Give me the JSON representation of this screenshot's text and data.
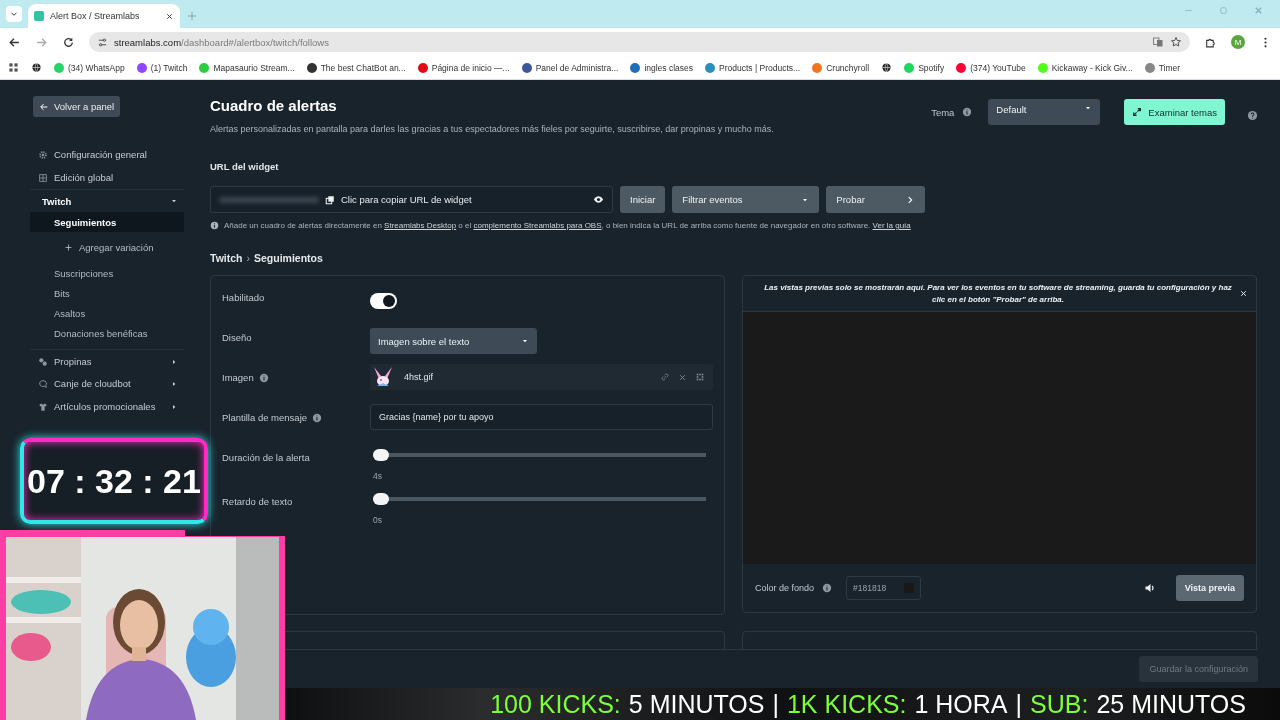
{
  "browser": {
    "tab_title": "Alert Box / Streamlabs",
    "url_host": "streamlabs.com",
    "url_path": "/dashboard#/alertbox/twitch/follows",
    "profile_initial": "M",
    "bookmarks": [
      {
        "color": "#222222"
      },
      {
        "label": "(34) WhatsApp",
        "color": "#25d366"
      },
      {
        "label": "(1) Twitch",
        "color": "#9146ff"
      },
      {
        "label": "Mapasaurio Stream...",
        "color": "#2ecc40"
      },
      {
        "label": "The best ChatBot an...",
        "color": "#333333"
      },
      {
        "label": "Página de inicio —...",
        "color": "#e50914"
      },
      {
        "label": "Panel de Administra...",
        "color": "#3b5998"
      },
      {
        "label": "ingles clases",
        "color": "#1e6fb8"
      },
      {
        "label": "Products | Products...",
        "color": "#2a8fbd"
      },
      {
        "label": "Crunchyroll",
        "color": "#f47521"
      },
      {
        "color": "#222222"
      },
      {
        "label": "Spotify",
        "color": "#1ed760"
      },
      {
        "label": "(374) YouTube",
        "color": "#ff0033"
      },
      {
        "label": "Kickaway - Kick Giv...",
        "color": "#53fc18"
      },
      {
        "label": "Timer",
        "color": "#888888"
      }
    ]
  },
  "sidebar": {
    "back_button": "Volver a panel",
    "items": [
      {
        "label": "Configuración general",
        "kind": "gear"
      },
      {
        "label": "Edición global",
        "kind": "grid"
      },
      {
        "label": "Twitch",
        "kind": "group",
        "expanded": true,
        "children": [
          {
            "label": "Seguimientos",
            "selected": true
          },
          {
            "label": "Agregar variación",
            "kind": "add",
            "selected": false
          },
          {
            "label": "Suscripciones",
            "selected": false
          },
          {
            "label": "Bits",
            "selected": false
          },
          {
            "label": "Asaltos",
            "selected": false
          },
          {
            "label": "Donaciones benéficas",
            "selected": false
          }
        ]
      },
      {
        "label": "Propinas",
        "kind": "coins",
        "expanded": false
      },
      {
        "label": "Canje de cloudbot",
        "kind": "chat",
        "expanded": false
      },
      {
        "label": "Artículos promocionales",
        "kind": "shirt",
        "expanded": false
      }
    ]
  },
  "header": {
    "title": "Cuadro de alertas",
    "subtitle": "Alertas personalizadas en pantalla para darles las gracias a tus espectadores más fieles por seguirte, suscribirse, dar propinas y mucho más.",
    "theme_label": "Tema",
    "theme_value": "Default",
    "browse_button": "Examinar temas"
  },
  "widget": {
    "label": "URL del widget",
    "copy_text": "Clic para copiar URL de widget",
    "start_button": "Iniciar",
    "filter_select": "Filtrar eventos",
    "test_button": "Probar",
    "info": [
      {
        "text": "Añade un cuadro de alertas directamente en "
      },
      {
        "text": "Streamlabs Desktop",
        "link": true
      },
      {
        "text": " o el "
      },
      {
        "text": "complemento Streamlabs para OBS",
        "link": true
      },
      {
        "text": ", o bien indica la URL de arriba como fuente de navegador en otro software. "
      },
      {
        "text": "Ver la guía",
        "link": true
      }
    ]
  },
  "breadcrumb": [
    "Twitch",
    "›",
    "Seguimientos"
  ],
  "settings": [
    {
      "label": "Habilitado",
      "kind": "toggle",
      "on": true
    },
    {
      "label": "Diseño",
      "kind": "select",
      "value": "Imagen sobre el texto"
    },
    {
      "label": "Imagen",
      "kind": "file",
      "info": true,
      "value": "4hst.gif"
    },
    {
      "label": "Plantilla de mensaje",
      "kind": "text",
      "info": true,
      "value": "Gracias {name} por tu apoyo"
    },
    {
      "label": "Duración de la alerta",
      "kind": "slider",
      "level": 0,
      "reading": "4s"
    },
    {
      "label": "Retardo de texto",
      "kind": "slider",
      "level": 0,
      "reading": "0s"
    }
  ],
  "preview": {
    "notice": "Las vistas previas solo se mostrarán aquí. Para ver los eventos en tu software de streaming, guarda tu configuración y haz clic en el botón \"Probar\" de arriba.",
    "bg_label": "Color de fondo",
    "bg_value": "#181818",
    "preview_button": "Vista previa"
  },
  "save_button": {
    "label": "Guardar la configuración",
    "disabled": true
  },
  "overlay": {
    "timer": "07 : 32 : 21",
    "ticker": [
      {
        "text": "100 KICKS:",
        "color": "#7dff3a"
      },
      {
        "text": "5 MINUTOS",
        "color": "#ffffff"
      },
      {
        "text": "|",
        "color": "#ffffff"
      },
      {
        "text": "1K KICKS:",
        "color": "#7dff3a"
      },
      {
        "text": "1 HORA",
        "color": "#ffffff"
      },
      {
        "text": "|",
        "color": "#ffffff"
      },
      {
        "text": "SUB:",
        "color": "#7dff3a"
      },
      {
        "text": "25 MINUTOS",
        "color": "#ffffff"
      }
    ]
  }
}
